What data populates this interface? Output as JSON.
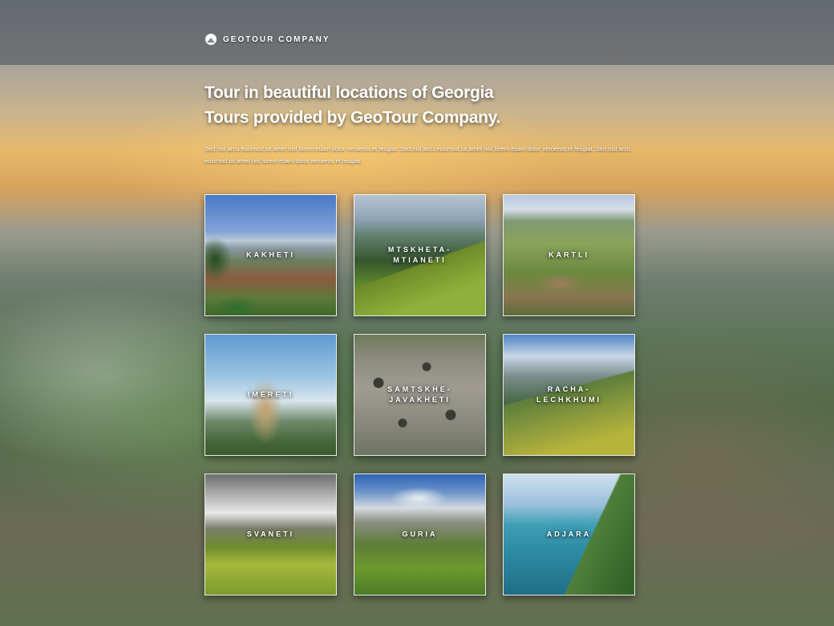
{
  "header": {
    "brand_icon": "cloud-mountain-icon",
    "brand_name": "GEOTOUR COMPANY"
  },
  "hero": {
    "title_line1": "Tour in beautiful locations of Georgia",
    "title_line2": "Tours provided by GeoTour Company.",
    "description": "Sed nisl arcu euismod sit amet nisl lorem etiam dolor veroeros et feugiat. Sed nisl arcu euismod sit amet nisl lorem etiam dolor veroeros et feugiat. Sed nisl arcu euismod sit amet nisl lorem etiam dolor veroeros et feugiat."
  },
  "regions": [
    {
      "label": "KAKHETI"
    },
    {
      "label": "MTSKHETA-MTIANETI"
    },
    {
      "label": "KARTLI"
    },
    {
      "label": "IMERETI"
    },
    {
      "label": "SAMTSKHE-JAVAKHETI"
    },
    {
      "label": "RACHA-LECHKHUMI"
    },
    {
      "label": "SVANETI"
    },
    {
      "label": "GURIA"
    },
    {
      "label": "ADJARA"
    }
  ]
}
